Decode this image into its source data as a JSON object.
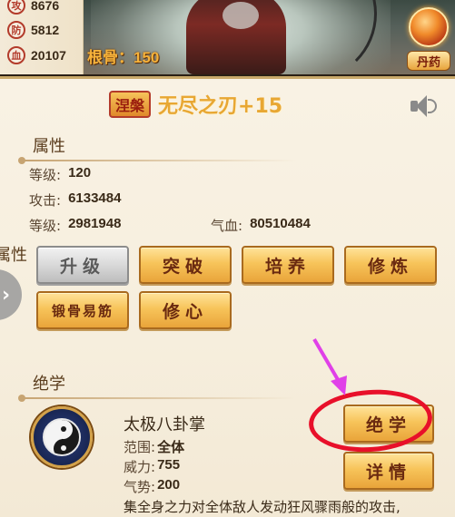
{
  "stats": [
    {
      "icon": "攻",
      "value": "8676"
    },
    {
      "icon": "防",
      "value": "5812"
    },
    {
      "icon": "血",
      "value": "20107"
    }
  ],
  "gengu": {
    "label": "根骨：",
    "value": "150"
  },
  "dan_button": {
    "label": "丹药"
  },
  "weapon": {
    "rank": "涅槃",
    "name": "无尽之刃+15"
  },
  "attributes_section": {
    "title": "属性",
    "side_label": "属性"
  },
  "attributes": {
    "level": {
      "label": "等级:",
      "value": "120"
    },
    "attack": {
      "label": "攻击:",
      "value": "6133484"
    },
    "defense": {
      "label": "等级:",
      "value": "2981948"
    },
    "hp": {
      "label": "气血:",
      "value": "80510484"
    }
  },
  "buttons": {
    "upgrade": "升级",
    "breakthrough": "突破",
    "cultivate": "培养",
    "refine": "修炼",
    "forge_bone": "锻骨易筋",
    "mind": "修心"
  },
  "skill_section": {
    "title": "绝学"
  },
  "skill": {
    "name": "太极八卦掌",
    "range": {
      "label": "范围:",
      "value": "全体"
    },
    "power": {
      "label": "威力:",
      "value": "755"
    },
    "momentum": {
      "label": "气势:",
      "value": "200"
    },
    "description": "集全身之力对全体敌人发动狂风骤雨般的攻击,"
  },
  "skill_buttons": {
    "juexue": "绝学",
    "detail": "详情"
  },
  "colors": {
    "gold_text": "#f6b23a",
    "button_gold": "#f7c45a",
    "annotation_red": "#e8102a",
    "annotation_pink": "#e040e8"
  }
}
